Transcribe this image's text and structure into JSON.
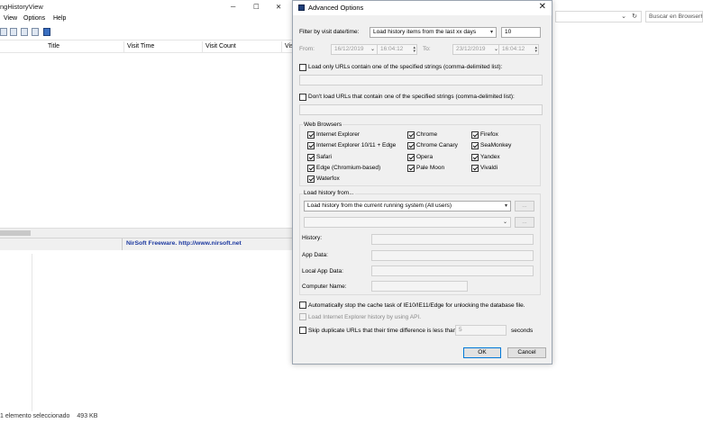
{
  "background_app": {
    "title_fragment": "ngHistoryView",
    "menu": [
      "View",
      "Options",
      "Help"
    ],
    "columns": [
      "Title",
      "Visit Time",
      "Visit Count",
      "Vis"
    ],
    "status_text": "NirSoft Freeware.  http://www.nirsoft.net"
  },
  "explorer": {
    "search_placeholder": "Buscar en BrowserHi",
    "status_items": "1 elemento seleccionado",
    "status_size": "493 KB"
  },
  "dialog": {
    "title": "Advanced Options",
    "filter_label": "Filter by visit date/time:",
    "filter_value": "Load history items from the last xx days",
    "days_value": "10",
    "from_label": "From:",
    "from_date": "16/12/2019",
    "from_time": "16:04:12",
    "to_label": "To:",
    "to_date": "23/12/2019",
    "to_time": "16:04:12",
    "only_urls_label": "Load only URLs contain one of the specified strings (comma-delimited list):",
    "dont_load_label": "Don't load URLs that contain one of the specified strings (comma-delimited list):",
    "browsers_group_label": "Web Browsers",
    "browsers": [
      "Internet Explorer",
      "Chrome",
      "Firefox",
      "Internet Explorer 10/11 + Edge",
      "Chrome Canary",
      "SeaMonkey",
      "Safari",
      "Opera",
      "Yandex",
      "Edge (Chromium-based)",
      "Pale Moon",
      "Vivaldi",
      "Waterfox"
    ],
    "load_from_label": "Load history from...",
    "load_from_value": "Load history from the current running system (All users)",
    "small_button": "...",
    "history_label": "History:",
    "app_data_label": "App Data:",
    "local_app_data_label": "Local App Data:",
    "computer_name_label": "Computer Name:",
    "auto_stop_label": "Automatically stop the cache task of IE10/IE11/Edge for unlocking the database file.",
    "ie_api_label": "Load Internet Explorer history by using API.",
    "skip_dup_label": "Skip duplicate URLs that their time difference is less than...",
    "skip_value": "5",
    "seconds_label": "seconds",
    "ok": "OK",
    "cancel": "Cancel"
  }
}
